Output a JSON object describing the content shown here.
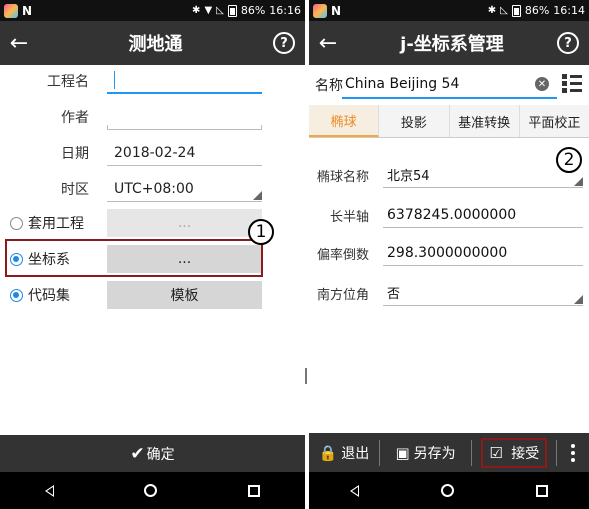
{
  "left": {
    "status": {
      "time": "16:16",
      "battery": "86%",
      "app_n": "N"
    },
    "appbar": {
      "back": "←",
      "title": "测地通",
      "help": "?"
    },
    "form": {
      "project_name_label": "工程名",
      "project_name_value": "",
      "author_label": "作者",
      "author_value": "",
      "date_label": "日期",
      "date_value": "2018-02-24",
      "timezone_label": "时区",
      "timezone_value": "UTC+08:00"
    },
    "options": {
      "apply_project_label": "套用工程",
      "apply_project_value": "...",
      "coord_sys_label": "坐标系",
      "coord_sys_value": "...",
      "code_set_label": "代码集",
      "code_set_value": "模板"
    },
    "marker": "1",
    "confirm_label": "确定"
  },
  "right": {
    "status": {
      "time": "16:14",
      "battery": "86%",
      "app_n": "N"
    },
    "appbar": {
      "back": "←",
      "title": "j-坐标系管理",
      "help": "?"
    },
    "name_label": "名称",
    "name_value": "China Beijing 54",
    "tabs": [
      "椭球",
      "投影",
      "基准转换",
      "平面校正"
    ],
    "fields": [
      {
        "label": "椭球名称",
        "value": "北京54"
      },
      {
        "label": "长半轴",
        "value": "6378245.0000000"
      },
      {
        "label": "偏率倒数",
        "value": "298.3000000000"
      },
      {
        "label": "南方位角",
        "value": "否"
      }
    ],
    "marker": "2",
    "bottom": {
      "exit": "退出",
      "save_as": "另存为",
      "accept": "接受"
    }
  },
  "colors": {
    "appbar": "#333333",
    "accent_blue": "#2196f3",
    "tab_orange": "#f08a24",
    "highlight_red": "#8b1a1a"
  }
}
